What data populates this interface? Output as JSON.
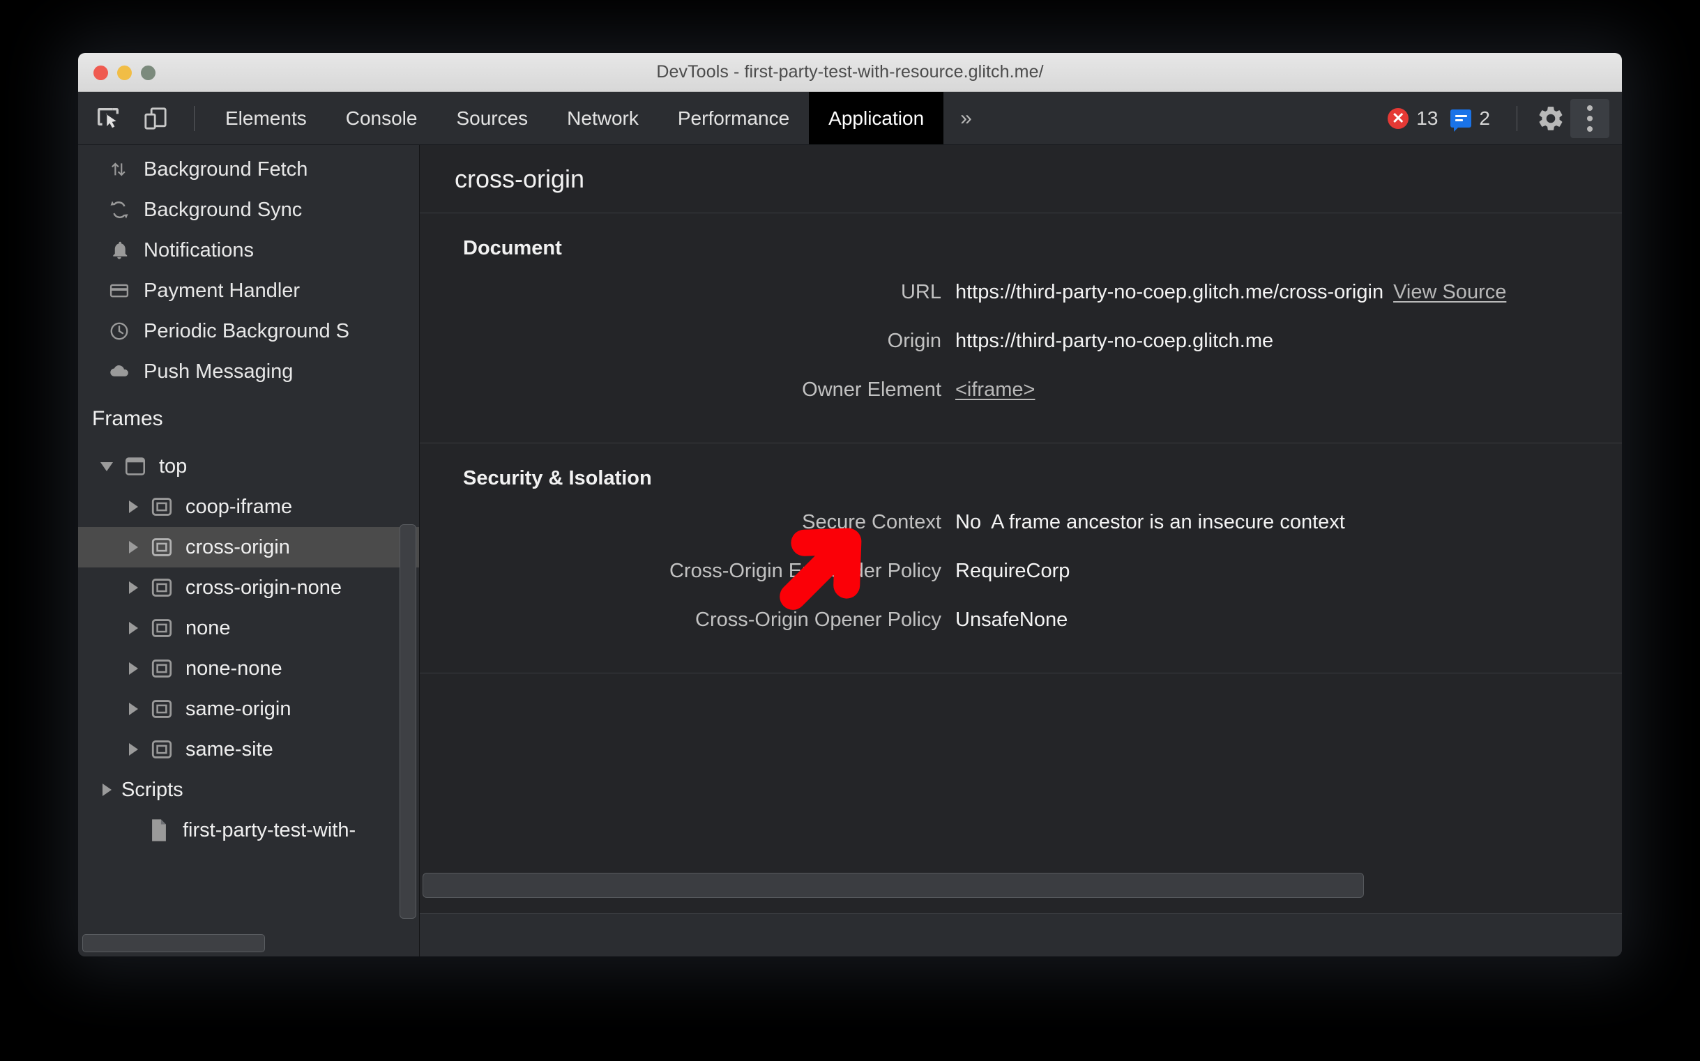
{
  "window": {
    "title": "DevTools - first-party-test-with-resource.glitch.me/",
    "traffic_lights": [
      "close-button",
      "minimize-button",
      "zoom-button"
    ]
  },
  "toolbar": {
    "inspect_icon": "inspect-element-icon",
    "device_icon": "device-toolbar-icon",
    "tabs": [
      {
        "label": "Elements",
        "active": false
      },
      {
        "label": "Console",
        "active": false
      },
      {
        "label": "Sources",
        "active": false
      },
      {
        "label": "Network",
        "active": false
      },
      {
        "label": "Performance",
        "active": false
      },
      {
        "label": "Application",
        "active": true
      }
    ],
    "more_tabs_label": "»",
    "error_count": "13",
    "message_count": "2",
    "settings_icon": "gear-icon",
    "menu_icon": "kebab-menu-icon",
    "error_color": "#e53935",
    "message_color": "#1a73e8"
  },
  "sidebar": {
    "background_services": [
      {
        "label": "Background Fetch",
        "icon": "background-fetch-icon"
      },
      {
        "label": "Background Sync",
        "icon": "background-sync-icon"
      },
      {
        "label": "Notifications",
        "icon": "bell-icon"
      },
      {
        "label": "Payment Handler",
        "icon": "credit-card-icon"
      },
      {
        "label": "Periodic Background S",
        "icon": "clock-icon"
      },
      {
        "label": "Push Messaging",
        "icon": "cloud-icon"
      }
    ],
    "frames_section_title": "Frames",
    "frames_tree": [
      {
        "label": "top",
        "icon": "page-frame-icon",
        "indent": 1,
        "twisty": "down",
        "selected": false
      },
      {
        "label": "coop-iframe",
        "icon": "iframe-icon",
        "indent": 2,
        "twisty": "right",
        "selected": false
      },
      {
        "label": "cross-origin",
        "icon": "iframe-icon",
        "indent": 2,
        "twisty": "right",
        "selected": true
      },
      {
        "label": "cross-origin-none",
        "icon": "iframe-icon",
        "indent": 2,
        "twisty": "right",
        "selected": false
      },
      {
        "label": "none",
        "icon": "iframe-icon",
        "indent": 2,
        "twisty": "right",
        "selected": false
      },
      {
        "label": "none-none",
        "icon": "iframe-icon",
        "indent": 2,
        "twisty": "right",
        "selected": false
      },
      {
        "label": "same-origin",
        "icon": "iframe-icon",
        "indent": 2,
        "twisty": "right",
        "selected": false
      },
      {
        "label": "same-site",
        "icon": "iframe-icon",
        "indent": 2,
        "twisty": "right",
        "selected": false
      },
      {
        "label": "Scripts",
        "icon": "none",
        "indent": 1,
        "twisty": "right",
        "selected": false
      },
      {
        "label": "first-party-test-with-",
        "icon": "document-icon",
        "indent": 3,
        "twisty": "none",
        "selected": false
      }
    ],
    "selection_color": "#4b4b4b"
  },
  "main": {
    "header_title": "cross-origin",
    "sections": [
      {
        "title": "Document",
        "fields": [
          {
            "label": "URL",
            "value": "https://third-party-no-coep.glitch.me/cross-origin",
            "link": "View Source"
          },
          {
            "label": "Origin",
            "value": "https://third-party-no-coep.glitch.me",
            "link": ""
          },
          {
            "label": "Owner Element",
            "value": "",
            "link": "<iframe>"
          }
        ]
      },
      {
        "title": "Security & Isolation",
        "fields": [
          {
            "label": "Secure Context",
            "value": "No",
            "note": "A frame ancestor is an insecure context"
          },
          {
            "label": "Cross-Origin Embedder Policy",
            "value": "RequireCorp"
          },
          {
            "label": "Cross-Origin Opener Policy",
            "value": "UnsafeNone"
          }
        ]
      }
    ]
  },
  "annotation": {
    "arrow_color": "#fb0007",
    "arrow_name": "red-annotation-arrow"
  }
}
